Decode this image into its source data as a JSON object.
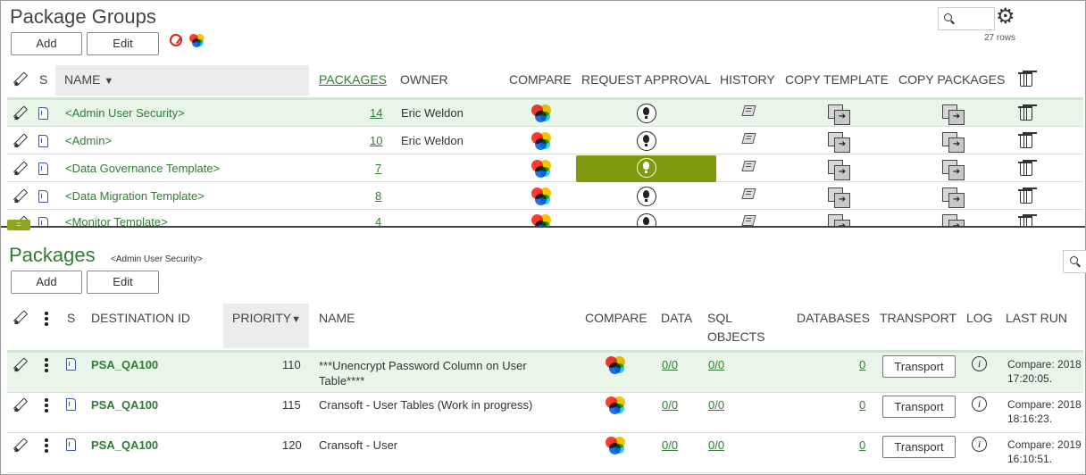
{
  "package_groups": {
    "title": "Package Groups",
    "add_label": "Add",
    "edit_label": "Edit",
    "rows_count": "27 rows",
    "columns": {
      "s": "S",
      "name": "NAME",
      "sort_arrow": "▼",
      "packages": "PACKAGES",
      "owner": "OWNER",
      "compare": "COMPARE",
      "request_approval": "REQUEST APPROVAL",
      "history": "HISTORY",
      "copy_template": "COPY TEMPLATE",
      "copy_packages": "COPY PACKAGES"
    },
    "rows": [
      {
        "name": "<Admin User Security>",
        "packages": "14",
        "owner": "Eric Weldon"
      },
      {
        "name": "<Admin>",
        "packages": "10",
        "owner": "Eric Weldon"
      },
      {
        "name": "<Data Governance Template>",
        "packages": "7",
        "owner": ""
      },
      {
        "name": "<Data Migration Template>",
        "packages": "8",
        "owner": ""
      },
      {
        "name": "<Monitor Template>",
        "packages": "4",
        "owner": ""
      }
    ],
    "splitter_glyph": "="
  },
  "packages": {
    "title": "Packages",
    "subtitle": "<Admin User Security>",
    "add_label": "Add",
    "edit_label": "Edit",
    "columns": {
      "s": "S",
      "destination_id": "DESTINATION ID",
      "priority": "PRIORITY",
      "sort_arrow": "▼",
      "name": "NAME",
      "compare": "COMPARE",
      "data": "DATA",
      "sql_line1": "SQL",
      "sql_line2": "OBJECTS",
      "databases": "DATABASES",
      "transport": "TRANSPORT",
      "log": "LOG",
      "last_run": "LAST RUN"
    },
    "rows": [
      {
        "dest": "PSA_QA100",
        "priority": "110",
        "name_line1": "***Unencrypt Password Column on User",
        "name_line2": "Table****",
        "data": "0/0",
        "sql": "0/0",
        "databases": "0",
        "transport": "Transport",
        "info": "i",
        "last_run_line1": "Compare: 2018",
        "last_run_line2": "17:20:05."
      },
      {
        "dest": "PSA_QA100",
        "priority": "115",
        "name_line1": "Cransoft - User Tables (Work in progress)",
        "name_line2": "",
        "data": "0/0",
        "sql": "0/0",
        "databases": "0",
        "transport": "Transport",
        "info": "i",
        "last_run_line1": "Compare: 2018",
        "last_run_line2": "18:16:23."
      },
      {
        "dest": "PSA_QA100",
        "priority": "120",
        "name_line1": "Cransoft - User",
        "name_line2": "",
        "data": "0/0",
        "sql": "0/0",
        "databases": "0",
        "transport": "Transport",
        "info": "i",
        "last_run_line1": "Compare: 2019",
        "last_run_line2": "16:10:51."
      }
    ]
  },
  "icons": {
    "gear": "gear-icon",
    "search": "search-icon",
    "edit": "pencil-icon",
    "doc": "document-icon",
    "compare": "color-circles-icon",
    "approval": "lightbulb-icon",
    "history": "history-icon",
    "copy": "copy-icon",
    "delete": "trash-icon",
    "info": "info-icon",
    "more": "kebab-menu-icon"
  },
  "colors": {
    "accent_green": "#2e7d32",
    "approval_highlight": "#7f9a0f",
    "selected_row": "#eaf5ea"
  }
}
